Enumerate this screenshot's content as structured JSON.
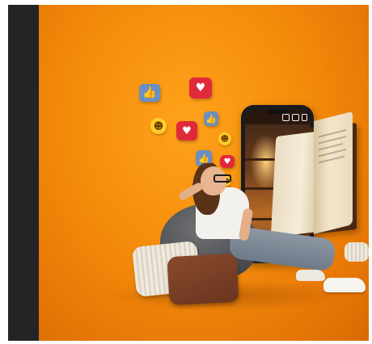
{
  "image": {
    "kind": "photo-illustration",
    "background_color": "#f48c0b",
    "left_strip_color": "#242426"
  },
  "icons": [
    {
      "name": "thumbs-up-icon"
    },
    {
      "name": "heart-bubble-icon"
    },
    {
      "name": "smiley-icon"
    },
    {
      "name": "heart-bubble-icon"
    },
    {
      "name": "thumbs-up-icon"
    },
    {
      "name": "smiley-icon"
    },
    {
      "name": "thumbs-up-icon"
    },
    {
      "name": "heart-bubble-icon"
    },
    {
      "name": "smiley-icon"
    },
    {
      "name": "heart-bubble-icon"
    }
  ]
}
